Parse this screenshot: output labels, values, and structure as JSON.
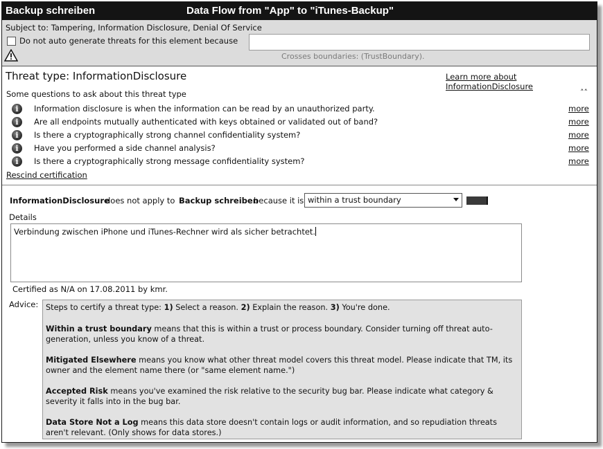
{
  "titlebar": {
    "left_title": "Backup schreiben",
    "center_title": "Data Flow from \"App\" to \"iTunes-Backup\""
  },
  "header": {
    "subject": "Subject to: Tampering, Information Disclosure, Denial Of Service",
    "no_autogen_label": "Do not auto generate threats for this element because",
    "no_autogen_checked": false,
    "reason_value": "",
    "crosses_boundaries": "Crosses boundaries: (TrustBoundary).",
    "warning_icon": "warning-triangle-icon"
  },
  "threat": {
    "title": "Threat type: InformationDisclosure",
    "learn_more": "Learn more about InformationDisclosure",
    "questions_title": "Some questions to ask about this threat type",
    "collapse_glyph": "˄˄",
    "info_icon": "info-icon",
    "questions": [
      {
        "text": "Information disclosure is when the information can be read by an unauthorized party.",
        "more": "more"
      },
      {
        "text": "Are all endpoints mutually authenticated with keys obtained or validated out of band?",
        "more": "more"
      },
      {
        "text": "Is there a cryptographically strong channel confidentiality system?",
        "more": "more"
      },
      {
        "text": "Have you performed a side channel analysis?",
        "more": "more"
      },
      {
        "text": "Is there a cryptographically strong message confidentiality system?",
        "more": "more"
      }
    ],
    "rescind": "Rescind certification"
  },
  "certification": {
    "threat_name": "InformationDisclosure",
    "does_not_apply": "does not apply to",
    "element_name": "Backup schreiben",
    "because": "because it is",
    "reason_selected": "within a trust boundary",
    "details_label": "Details",
    "details_text": "Verbindung zwischen iPhone und iTunes-Rechner wird als sicher betrachtet.",
    "certified_line": "Certified as N/A on 17.08.2011 by kmr."
  },
  "advice": {
    "label": "Advice:",
    "steps_prefix": "Steps to certify a threat type: ",
    "step1": "1)",
    "step1_text": " Select a reason. ",
    "step2": "2)",
    "step2_text": " Explain the reason. ",
    "step3": "3)",
    "step3_text": " You're done.",
    "items": [
      {
        "term": "Within a trust boundary",
        "text": " means that this is within a trust or process boundary.  Consider turning off threat auto-generation, unless you know of a threat."
      },
      {
        "term": "Mitigated Elsewhere",
        "text": " means you know what other threat model covers this threat model.  Please indicate that TM, its owner and the element name there (or \"same element name.\")"
      },
      {
        "term": "Accepted Risk",
        "text": " means you've examined the risk relative to the security bug bar.  Please indicate what category & severity it falls into in the bug bar."
      },
      {
        "term": "Data Store Not a Log",
        "text": " means this data store doesn't contain logs or audit information, and so repudiation threats aren't relevant.  (Only shows for data stores.)"
      }
    ]
  }
}
